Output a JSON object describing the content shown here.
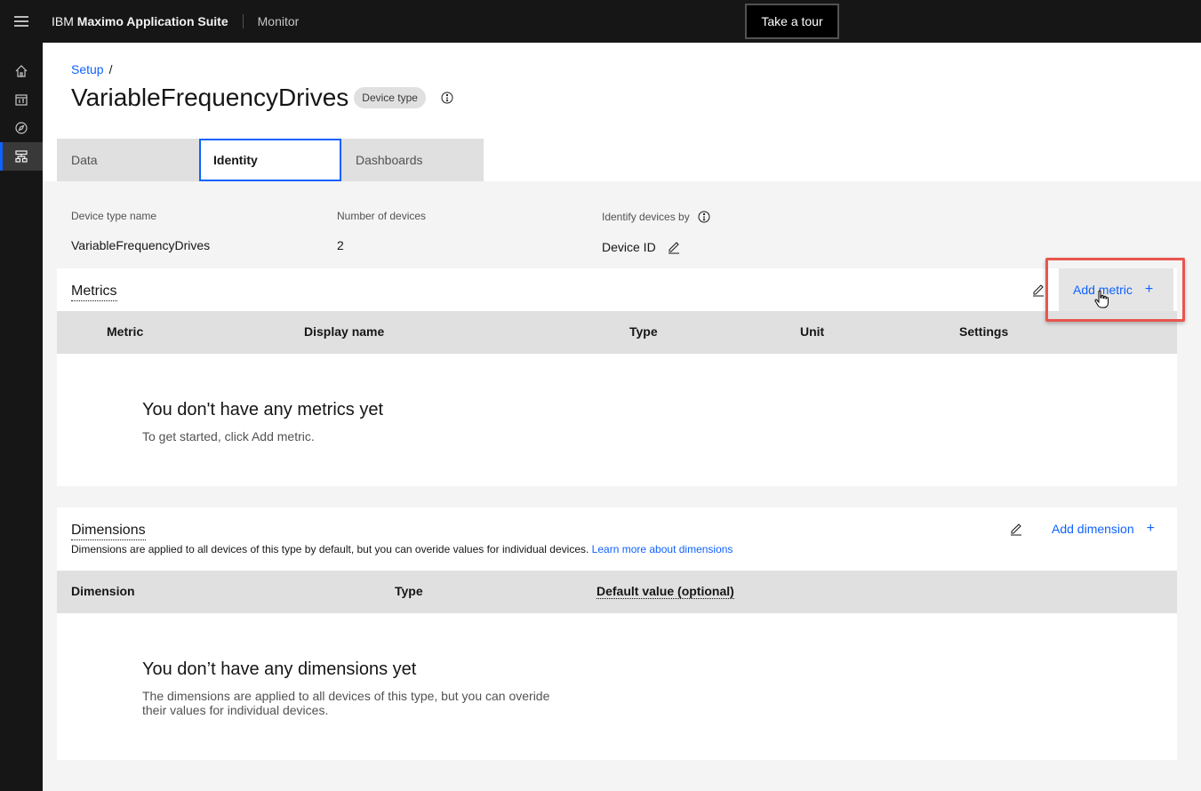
{
  "header": {
    "brand_ibm": "IBM",
    "brand_suite": "Maximo Application Suite",
    "app_name": "Monitor",
    "tour_label": "Take a tour"
  },
  "rail": {
    "items": [
      {
        "name": "home-icon"
      },
      {
        "name": "calendar-icon"
      },
      {
        "name": "compass-icon"
      },
      {
        "name": "data-structure-icon",
        "active": true
      }
    ]
  },
  "breadcrumb": {
    "root": "Setup",
    "separator": "/"
  },
  "page": {
    "title": "VariableFrequencyDrives",
    "tag": "Device type"
  },
  "tabs": [
    {
      "label": "Data"
    },
    {
      "label": "Identity",
      "selected": true
    },
    {
      "label": "Dashboards"
    }
  ],
  "summary": {
    "device_type_name_label": "Device type name",
    "device_type_name_value": "VariableFrequencyDrives",
    "num_devices_label": "Number of devices",
    "num_devices_value": "2",
    "identify_by_label": "Identify devices by",
    "identify_by_value": "Device ID"
  },
  "metrics": {
    "title": "Metrics",
    "add_label": "Add metric",
    "columns": [
      "Metric",
      "Display name",
      "Type",
      "Unit",
      "Settings"
    ],
    "empty_title": "You don't have any metrics yet",
    "empty_text": "To get started, click Add metric."
  },
  "dimensions": {
    "title": "Dimensions",
    "description": "Dimensions are applied to all devices of this type by default, but you can overide values for individual devices.",
    "learn_more": "Learn more about dimensions",
    "add_label": "Add dimension",
    "columns": [
      "Dimension",
      "Type",
      "Default value (optional)"
    ],
    "empty_title": "You don’t have any dimensions yet",
    "empty_text": "The dimensions are applied to all devices of this type, but you can overide their values for individual devices."
  },
  "colors": {
    "accent": "#0f62fe",
    "highlight": "#e8554e",
    "header_bg": "#161616"
  }
}
